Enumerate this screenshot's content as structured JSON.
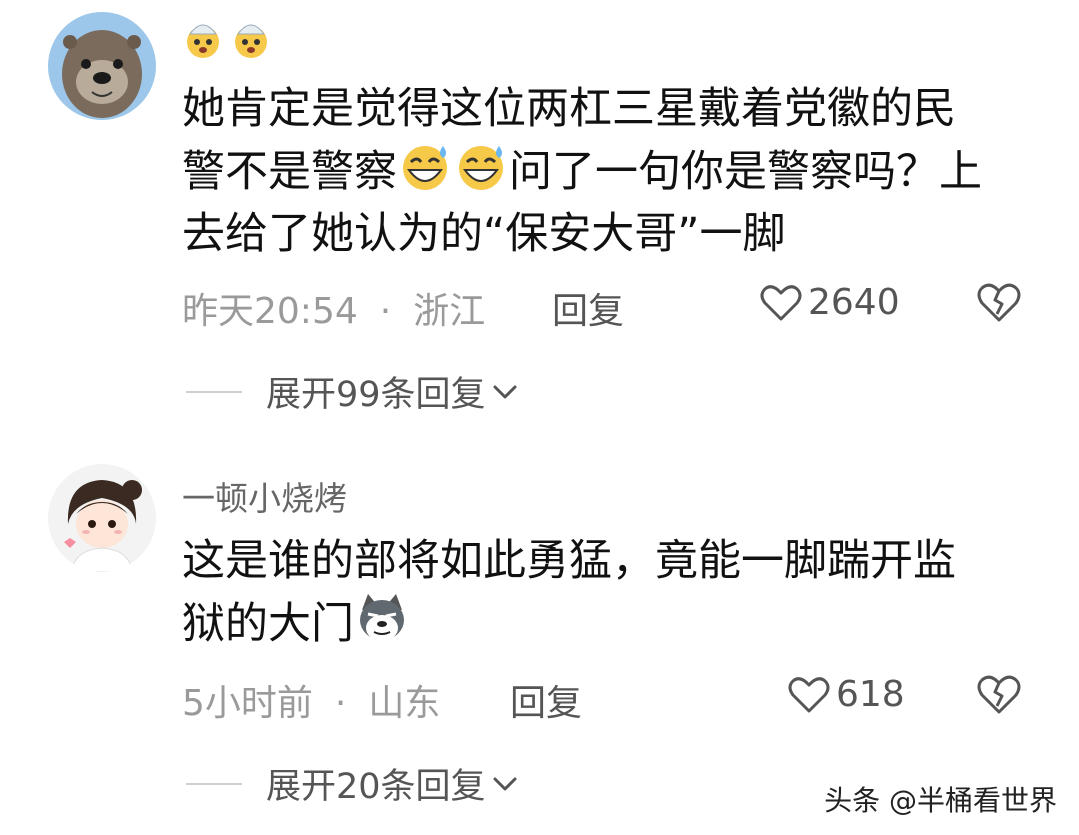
{
  "comments": [
    {
      "username_emojis": [
        "exploding-head-icon",
        "exploding-head-icon"
      ],
      "text_lines": [
        "她肯定是觉得这位两杠三星戴着党徽的民",
        [
          "警不是警察",
          "问了一句你是警察吗？上"
        ],
        "去给了她认为的“保安大哥”一脚"
      ],
      "inline_emojis": [
        "grin-sweat-icon",
        "grin-sweat-icon"
      ],
      "time": "昨天20:54",
      "separator": "·",
      "location": "浙江",
      "reply_label": "回复",
      "likes": "2640",
      "expand_label": "展开99条回复"
    },
    {
      "username": "一顿小烧烤",
      "text_lines": [
        "这是谁的部将如此勇猛，竟能一脚踹开监",
        "狱的大门"
      ],
      "inline_emojis": [
        "husky-icon"
      ],
      "time": "5小时前",
      "separator": "·",
      "location": "山东",
      "reply_label": "回复",
      "likes": "618",
      "expand_label": "展开20条回复"
    }
  ],
  "watermark": "头条 @半桶看世界"
}
